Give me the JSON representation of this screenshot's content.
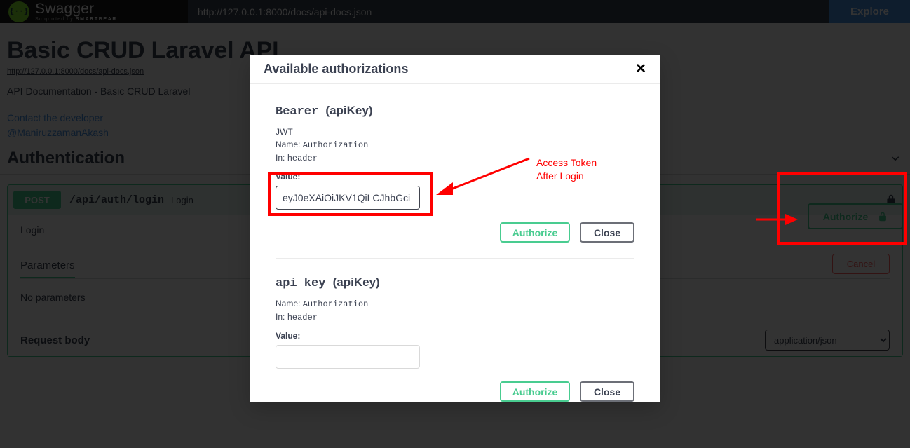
{
  "topbar": {
    "logo_text": "Swagger",
    "logo_sub_prefix": "Supported by ",
    "logo_sub_brand": "SMARTBEAR",
    "logo_glyph": "{··}",
    "url_value": "http://127.0.0.1:8000/docs/api-docs.json",
    "url_placeholder": "http://127.0.0.1:8000/docs/api-docs.json",
    "explore_label": "Explore"
  },
  "info": {
    "title": "Basic CRUD Laravel API",
    "spec_url": "http://127.0.0.1:8000/docs/api-docs.json",
    "description": "API Documentation - Basic CRUD Laravel",
    "contact_label": "Contact the developer",
    "contact_handle": "@ManiruzzamanAkash"
  },
  "authorize_button": {
    "label": "Authorize",
    "icon": "unlock-icon"
  },
  "tag_section": {
    "name": "Authentication",
    "collapse_icon": "chevron-down-icon"
  },
  "operation": {
    "method": "POST",
    "path": "/api/auth/login",
    "summary": "Login",
    "description": "Login",
    "lock_icon": "lock-closed-icon",
    "tab_label": "Parameters",
    "cancel_label": "Cancel",
    "no_parameters": "No parameters",
    "request_body_label": "Request body",
    "media_type": "application/json",
    "media_options": [
      "application/json"
    ]
  },
  "modal": {
    "title": "Available authorizations",
    "close_icon": "close-icon",
    "schemes": [
      {
        "name": "Bearer",
        "kind": "(apiKey)",
        "description": "JWT",
        "name_line_label": "Name:",
        "name_line_value": "Authorization",
        "in_line_label": "In:",
        "in_line_value": "header",
        "value_label": "Value:",
        "value": "eyJ0eXAiOiJKV1QiLCJhbGci",
        "placeholder": "",
        "authorize_label": "Authorize",
        "close_label": "Close"
      },
      {
        "name": "api_key",
        "kind": "(apiKey)",
        "description": "",
        "name_line_label": "Name:",
        "name_line_value": "Authorization",
        "in_line_label": "In:",
        "in_line_value": "header",
        "value_label": "Value:",
        "value": "",
        "placeholder": "",
        "authorize_label": "Authorize",
        "close_label": "Close"
      }
    ]
  },
  "annotations": {
    "color": "#ff0000",
    "token_note_line1": "Access Token",
    "token_note_line2": "After Login"
  }
}
